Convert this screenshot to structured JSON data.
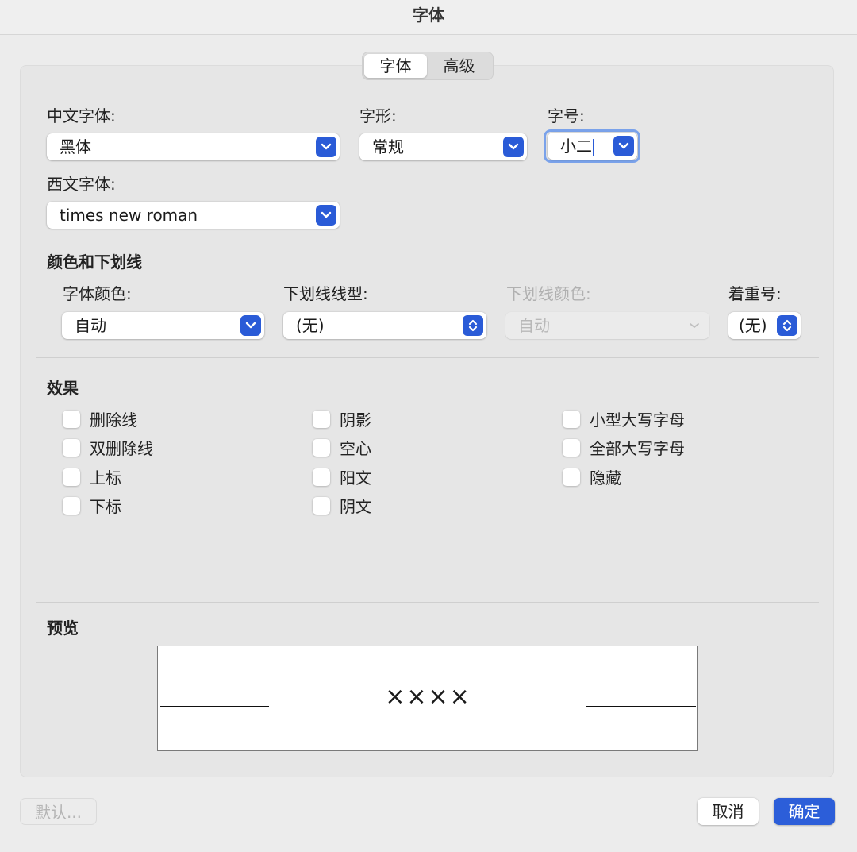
{
  "window": {
    "title": "字体"
  },
  "tabs": [
    {
      "label": "字体",
      "active": true
    },
    {
      "label": "高级",
      "active": false
    }
  ],
  "font": {
    "chinese_font_label": "中文字体:",
    "chinese_font_value": "黑体",
    "style_label": "字形:",
    "style_value": "常规",
    "size_label": "字号:",
    "size_value": "小二",
    "western_font_label": "西文字体:",
    "western_font_value": "times new roman"
  },
  "color_underline": {
    "section_title": "颜色和下划线",
    "font_color_label": "字体颜色:",
    "font_color_value": "自动",
    "underline_style_label": "下划线线型:",
    "underline_style_value": "(无)",
    "underline_color_label": "下划线颜色:",
    "underline_color_value": "自动",
    "emphasis_label": "着重号:",
    "emphasis_value": "(无)"
  },
  "effects": {
    "section_title": "效果",
    "col1": [
      {
        "label": "删除线",
        "checked": false
      },
      {
        "label": "双删除线",
        "checked": false
      },
      {
        "label": "上标",
        "checked": false
      },
      {
        "label": "下标",
        "checked": false
      }
    ],
    "col2": [
      {
        "label": "阴影",
        "checked": false
      },
      {
        "label": "空心",
        "checked": false
      },
      {
        "label": "阳文",
        "checked": false
      },
      {
        "label": "阴文",
        "checked": false
      }
    ],
    "col3": [
      {
        "label": "小型大写字母",
        "checked": false
      },
      {
        "label": "全部大写字母",
        "checked": false
      },
      {
        "label": "隐藏",
        "checked": false
      }
    ]
  },
  "preview": {
    "section_title": "预览",
    "sample_text": "××××"
  },
  "buttons": {
    "default_label": "默认...",
    "cancel_label": "取消",
    "ok_label": "确定"
  },
  "colors": {
    "accent": "#2a5bd7",
    "focus_ring": "#7aa2ea",
    "disabled_text": "#b0b0b0"
  }
}
